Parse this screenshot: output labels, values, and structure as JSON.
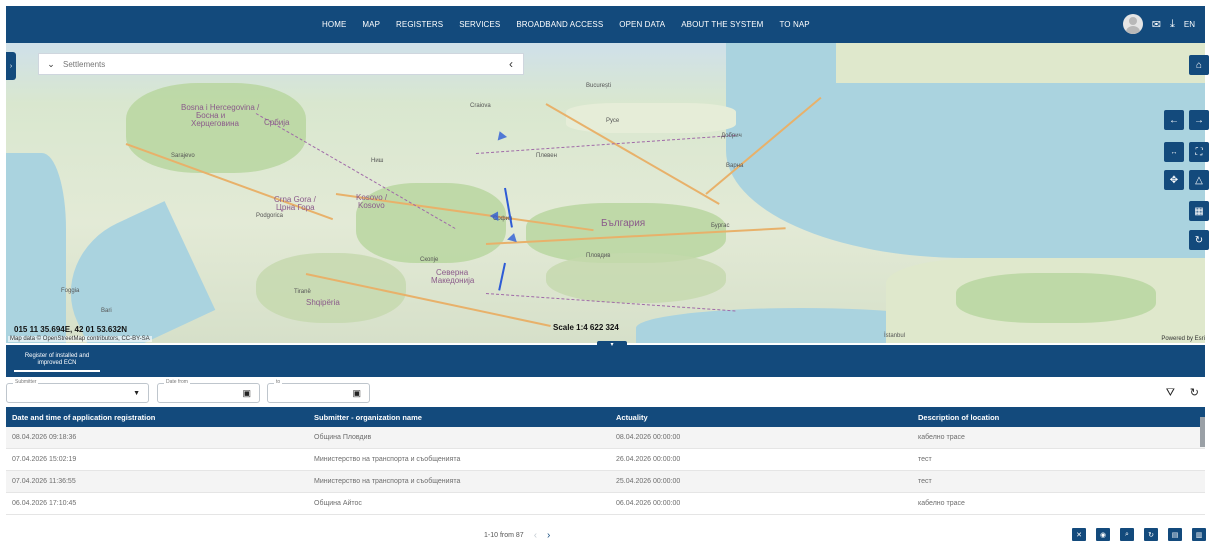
{
  "nav": {
    "items": [
      "HOME",
      "MAP",
      "REGISTERS",
      "SERVICES",
      "BROADBAND ACCESS",
      "OPEN DATA",
      "ABOUT THE SYSTEM",
      "TO NAP"
    ],
    "lang": "EN"
  },
  "map": {
    "search_placeholder": "Settlements",
    "coords": "015 11 35.694E, 42 01 53.632N",
    "scale": "Scale 1:4 622 324",
    "attribution": "Map data © OpenStreetMap contributors, CC-BY-SA",
    "powered": "Powered by Esri",
    "labels": {
      "srbija": "Србија",
      "bosna": "Bosna i Hercegovina /",
      "bosna2": "Босна и",
      "bosna3": "Херцеговина",
      "crnagora": "Crna Gora /",
      "crnagora2": "Црна Гора",
      "kosovo": "Kosovo /",
      "kosovo2": "Kosovo",
      "makedonija": "Северна",
      "makedonija2": "Македонија",
      "shqiperia": "Shqipëria",
      "bulgaria": "България",
      "bucuresti": "București",
      "istanbul": "İstanbul",
      "craiova": "Craiova",
      "sofia": "София",
      "plovdiv": "Пловдив",
      "varna": "Варна",
      "burgas": "Бургас",
      "skopje": "Скопје",
      "tirane": "Tiranë",
      "podgorica": "Podgorica",
      "sarajevo": "Sarajevo",
      "nis": "Ниш",
      "pleven": "Плевен",
      "ruse": "Русе",
      "dobrich": "Добрич",
      "bari": "Bari",
      "foggia": "Foggia"
    }
  },
  "panel": {
    "tab_label": "Register of installed and improved ECN"
  },
  "filters": {
    "submitter_label": "Submitter",
    "date_from_label": "Date from",
    "to_label": "to"
  },
  "table": {
    "headers": [
      "Date and time of application registration",
      "Submitter - organization name",
      "Actuality",
      "Description of location"
    ],
    "rows": [
      [
        "08.04.2026 09:18:36",
        "Община Пловдив",
        "08.04.2026 00:00:00",
        "кабелно трасе"
      ],
      [
        "07.04.2026 15:02:19",
        "Министерство на транспорта и съобщенията",
        "26.04.2026 00:00:00",
        "тест"
      ],
      [
        "07.04.2026 11:36:55",
        "Министерство на транспорта и съобщенията",
        "25.04.2026 00:00:00",
        "тест"
      ],
      [
        "06.04.2026 17:10:45",
        "Община Айтос",
        "06.04.2026 00:00:00",
        "кабелно трасе"
      ]
    ]
  },
  "pager": {
    "text": "1-10 from 87"
  },
  "colors": {
    "primary": "#134a7c",
    "sea": "#aad3df",
    "marker": "#2d5bd6"
  }
}
